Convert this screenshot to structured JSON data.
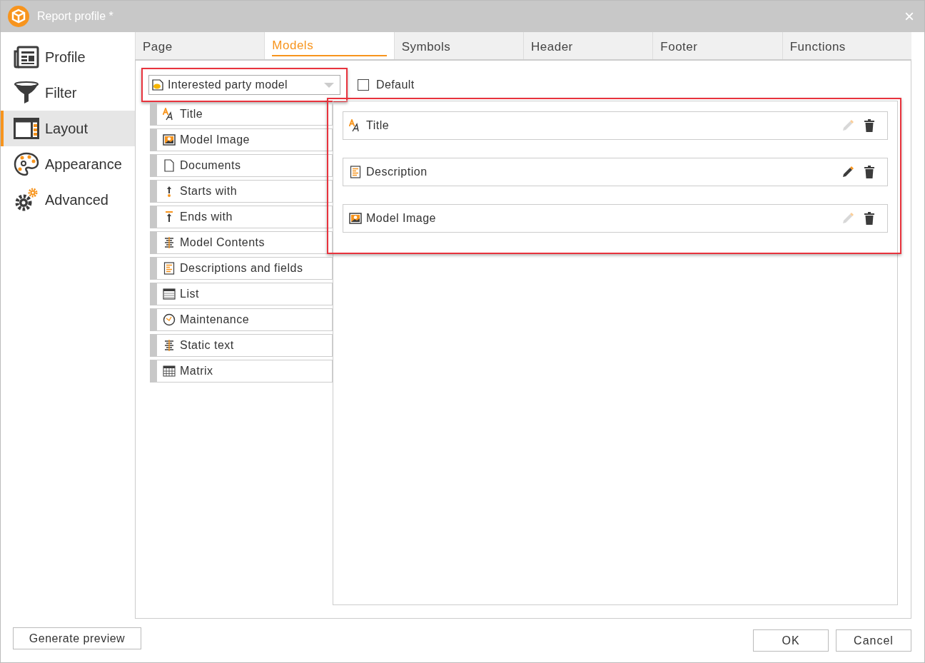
{
  "window": {
    "title": "Report profile *",
    "close": "×"
  },
  "sidebar": {
    "items": [
      {
        "label": "Profile",
        "kind": "profile",
        "selected": false
      },
      {
        "label": "Filter",
        "kind": "filter",
        "selected": false
      },
      {
        "label": "Layout",
        "kind": "layout",
        "selected": true
      },
      {
        "label": "Appearance",
        "kind": "appearance",
        "selected": false
      },
      {
        "label": "Advanced",
        "kind": "advanced",
        "selected": false
      }
    ]
  },
  "tabs": [
    {
      "label": "Page",
      "selected": false
    },
    {
      "label": "Models",
      "selected": true
    },
    {
      "label": "Symbols",
      "selected": false
    },
    {
      "label": "Header",
      "selected": false
    },
    {
      "label": "Footer",
      "selected": false
    },
    {
      "label": "Functions",
      "selected": false
    }
  ],
  "model_select": {
    "value": "Interested party model",
    "highlighted": true
  },
  "default_checkbox": {
    "label": "Default",
    "checked": false
  },
  "available_items": [
    {
      "label": "Title",
      "kind": "title"
    },
    {
      "label": "Model Image",
      "kind": "image"
    },
    {
      "label": "Documents",
      "kind": "document"
    },
    {
      "label": "Starts with",
      "kind": "starts"
    },
    {
      "label": "Ends with",
      "kind": "ends"
    },
    {
      "label": "Model Contents",
      "kind": "contents"
    },
    {
      "label": "Descriptions and fields",
      "kind": "description"
    },
    {
      "label": "List",
      "kind": "list"
    },
    {
      "label": "Maintenance",
      "kind": "clock"
    },
    {
      "label": "Static text",
      "kind": "contents"
    },
    {
      "label": "Matrix",
      "kind": "matrix"
    }
  ],
  "selected_items": {
    "highlighted": true,
    "rows": [
      {
        "label": "Title",
        "kind": "title",
        "editable": false
      },
      {
        "label": "Description",
        "kind": "description",
        "editable": true
      },
      {
        "label": "Model Image",
        "kind": "image",
        "editable": false
      }
    ]
  },
  "footer": {
    "preview_button": "Generate preview",
    "buttons": [
      "OK",
      "Cancel"
    ]
  }
}
